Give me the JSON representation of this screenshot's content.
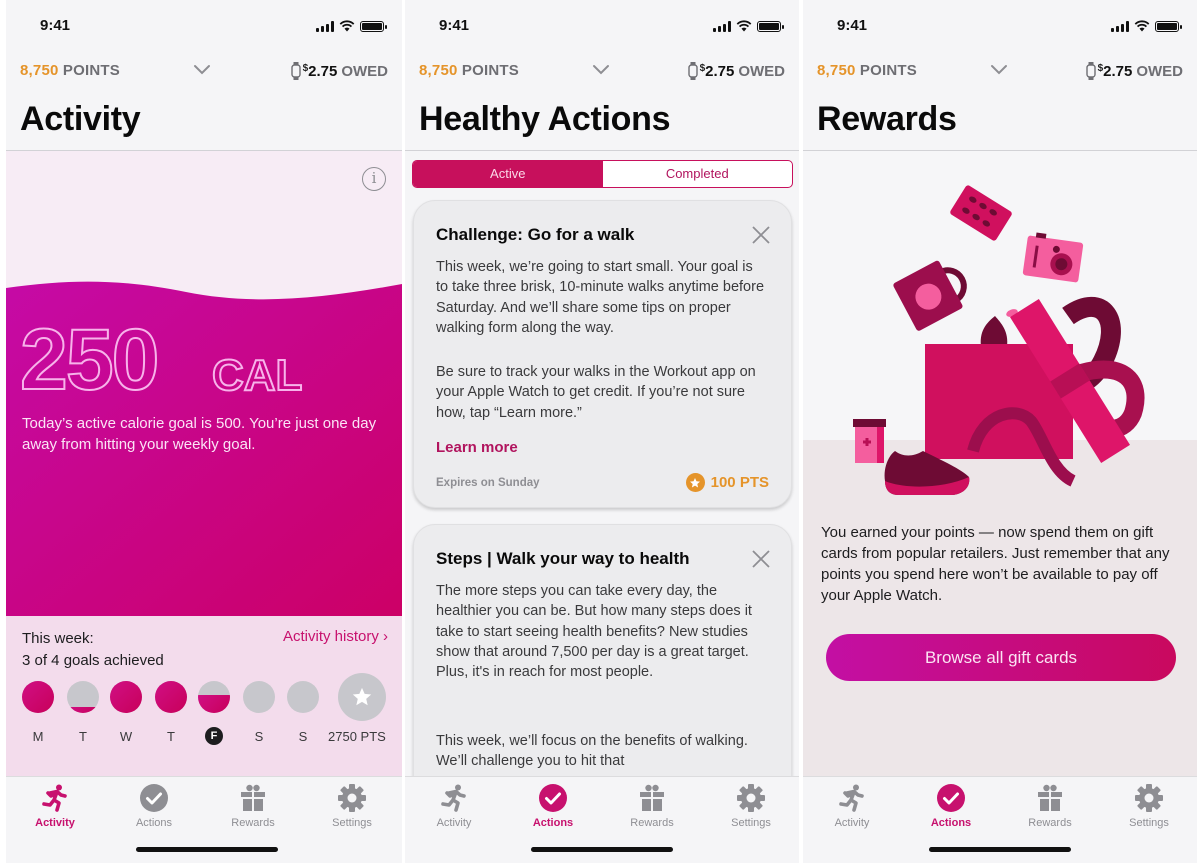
{
  "shared": {
    "status_time": "9:41",
    "points_value": "8,750",
    "points_label": "POINTS",
    "owed_currency": "$",
    "owed_amount": "2.75",
    "owed_label": "OWED",
    "tabs": [
      {
        "label": "Activity",
        "icon": "runner-icon"
      },
      {
        "label": "Actions",
        "icon": "checkmark-circle-icon"
      },
      {
        "label": "Rewards",
        "icon": "gift-icon"
      },
      {
        "label": "Settings",
        "icon": "gear-icon"
      }
    ],
    "colors": {
      "accent": "#c7116e",
      "points": "#e5942a",
      "inactive": "#8e8e93"
    }
  },
  "activity_screen": {
    "title": "Activity",
    "active_tab": "Activity",
    "calories": "250",
    "calories_unit": "CAL",
    "description": "Today’s active calorie goal is 500. You’re just one day away from hitting your weekly goal.",
    "week_label": "This week:",
    "goals_summary": "3 of 4 goals achieved",
    "history_link": "Activity history ›",
    "days": [
      {
        "label": "M",
        "progress": 1.0,
        "today": false
      },
      {
        "label": "T",
        "progress": 0.2,
        "today": false
      },
      {
        "label": "W",
        "progress": 1.0,
        "today": false
      },
      {
        "label": "T",
        "progress": 1.0,
        "today": false
      },
      {
        "label": "F",
        "progress": 0.55,
        "today": true
      },
      {
        "label": "S",
        "progress": 0.0,
        "today": false
      },
      {
        "label": "S",
        "progress": 0.0,
        "today": false
      }
    ],
    "weekly_reward": "2750 PTS"
  },
  "actions_screen": {
    "title": "Healthy Actions",
    "active_tab": "Actions",
    "segments": {
      "active": "Active",
      "completed": "Completed",
      "selected": "Active"
    },
    "cards": [
      {
        "title": "Challenge: Go for a walk",
        "body": [
          "This week, we’re going to start small. Your goal is to take three brisk, 10-minute walks anytime before Saturday. And we’ll share some tips on proper walking form along the way.",
          "Be sure to track your walks in the Workout app on your Apple Watch to get credit. If you’re not sure how, tap “Learn more.”"
        ],
        "link": "Learn more",
        "expires": "Expires on Sunday",
        "points": "100 PTS"
      },
      {
        "title": "Steps | Walk your way to health",
        "body": [
          "The more steps you can take every day, the healthier you can be. But how many steps does it take to start seeing health benefits? New studies show that around 7,500 per day is a great target. Plus, it's in reach for most people.",
          "This week, we’ll focus on the benefits of walking. We’ll challenge you to hit that"
        ]
      }
    ]
  },
  "rewards_screen": {
    "title": "Rewards",
    "active_tab": "Actions",
    "description": "You earned your points — now spend them on gift cards from popular retailers. Just remember that any points you spend here won’t be available to pay off your Apple Watch.",
    "button": "Browse all gift cards"
  }
}
